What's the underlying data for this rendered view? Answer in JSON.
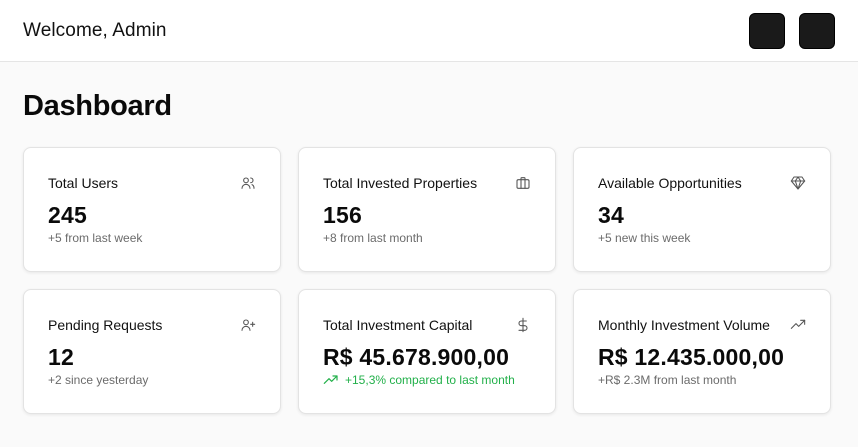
{
  "header": {
    "welcome": "Welcome, Admin"
  },
  "page": {
    "title": "Dashboard"
  },
  "cards": [
    {
      "title": "Total Users",
      "value": "245",
      "sub": "+5 from last week",
      "icon": "users-icon"
    },
    {
      "title": "Total Invested Properties",
      "value": "156",
      "sub": "+8 from last month",
      "icon": "briefcase-icon"
    },
    {
      "title": "Available Opportunities",
      "value": "34",
      "sub": "+5 new this week",
      "icon": "gem-icon"
    },
    {
      "title": "Pending Requests",
      "value": "12",
      "sub": "+2 since yesterday",
      "icon": "user-plus-icon"
    },
    {
      "title": "Total Investment Capital",
      "value": "R$ 45.678.900,00",
      "sub": "+15,3% compared to last month",
      "icon": "dollar-icon"
    },
    {
      "title": "Monthly Investment Volume",
      "value": "R$ 12.435.000,00",
      "sub": "+R$ 2.3M from last month",
      "icon": "trending-up-icon"
    }
  ],
  "colors": {
    "positive": "#22b04a",
    "button": "#1a1a1a"
  }
}
